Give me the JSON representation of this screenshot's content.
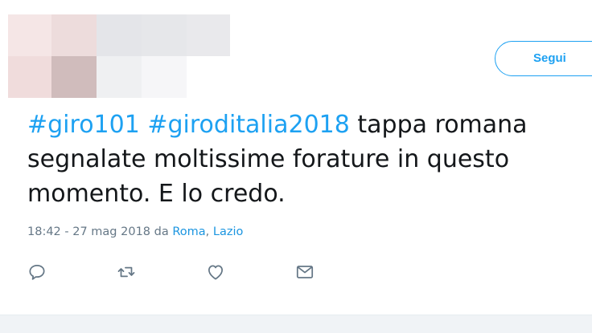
{
  "header": {
    "follow_button_label": "Segui",
    "avatar_icon": "pixelated-avatar"
  },
  "tweet": {
    "hashtag_1": "#giro101",
    "hashtag_2": "#giroditalia2018",
    "text_line_1": " tappa romana",
    "text_line_2": "segnalate moltissime forature in questo",
    "text_line_3": "momento. E lo credo."
  },
  "meta": {
    "timestamp": "18:42 - 27 mag 2018",
    "via_label": " da ",
    "location_city": "Roma",
    "location_separator": ", ",
    "location_region": "Lazio"
  },
  "actions": {
    "icons": [
      "reply-icon",
      "retweet-icon",
      "like-icon",
      "direct-message-icon"
    ]
  },
  "colors": {
    "accent": "#1da1f2",
    "text": "#14171a",
    "muted": "#657786",
    "icon": "#657786"
  }
}
